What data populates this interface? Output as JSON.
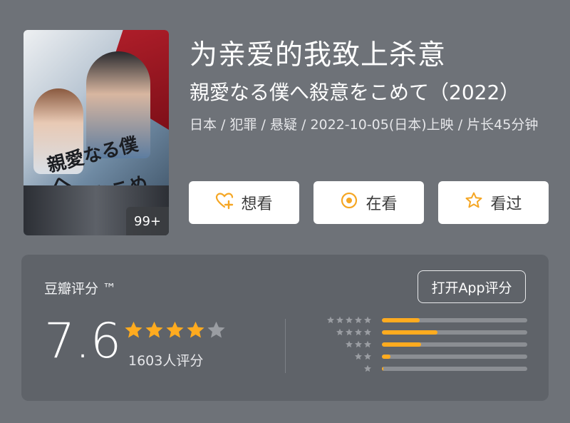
{
  "poster": {
    "title_text": "親愛なる僕へ殺意をこめて",
    "count_badge": "99+"
  },
  "movie": {
    "title_cn": "为亲爱的我致上杀意",
    "title_jp": "親愛なる僕へ殺意をこめて（2022）",
    "meta": "日本 / 犯罪 / 悬疑 / 2022-10-05(日本)上映 / 片长45分钟"
  },
  "actions": [
    {
      "label": "想看",
      "icon": "heart-plus-icon"
    },
    {
      "label": "在看",
      "icon": "dot-circle-icon"
    },
    {
      "label": "看过",
      "icon": "star-outline-icon"
    }
  ],
  "rating": {
    "label": "豆瓣评分 ™",
    "open_app": "打开App评分",
    "score": "7.6",
    "stars_filled": 4,
    "stars_total": 5,
    "votes": "1603人评分",
    "distribution": [
      {
        "stars": 5,
        "fraction": 0.26
      },
      {
        "stars": 4,
        "fraction": 0.38
      },
      {
        "stars": 3,
        "fraction": 0.27
      },
      {
        "stars": 2,
        "fraction": 0.06
      },
      {
        "stars": 1,
        "fraction": 0.01
      }
    ]
  },
  "colors": {
    "background": "#6e7278",
    "card": "#5f6369",
    "accent": "#ffab1f",
    "star_empty": "#9a9da2"
  }
}
